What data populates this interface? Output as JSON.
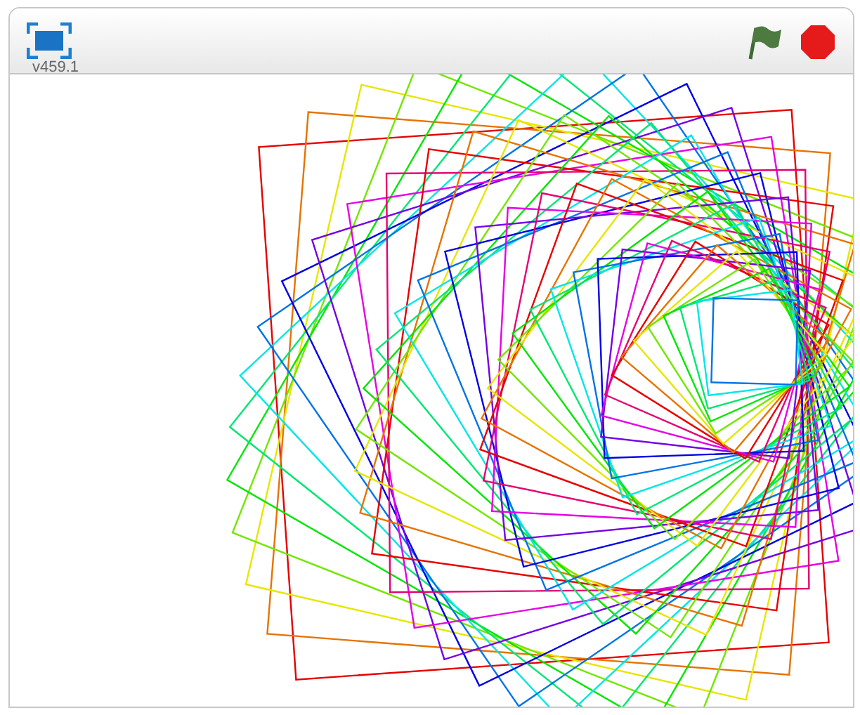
{
  "player": {
    "version": "v459.1"
  }
}
